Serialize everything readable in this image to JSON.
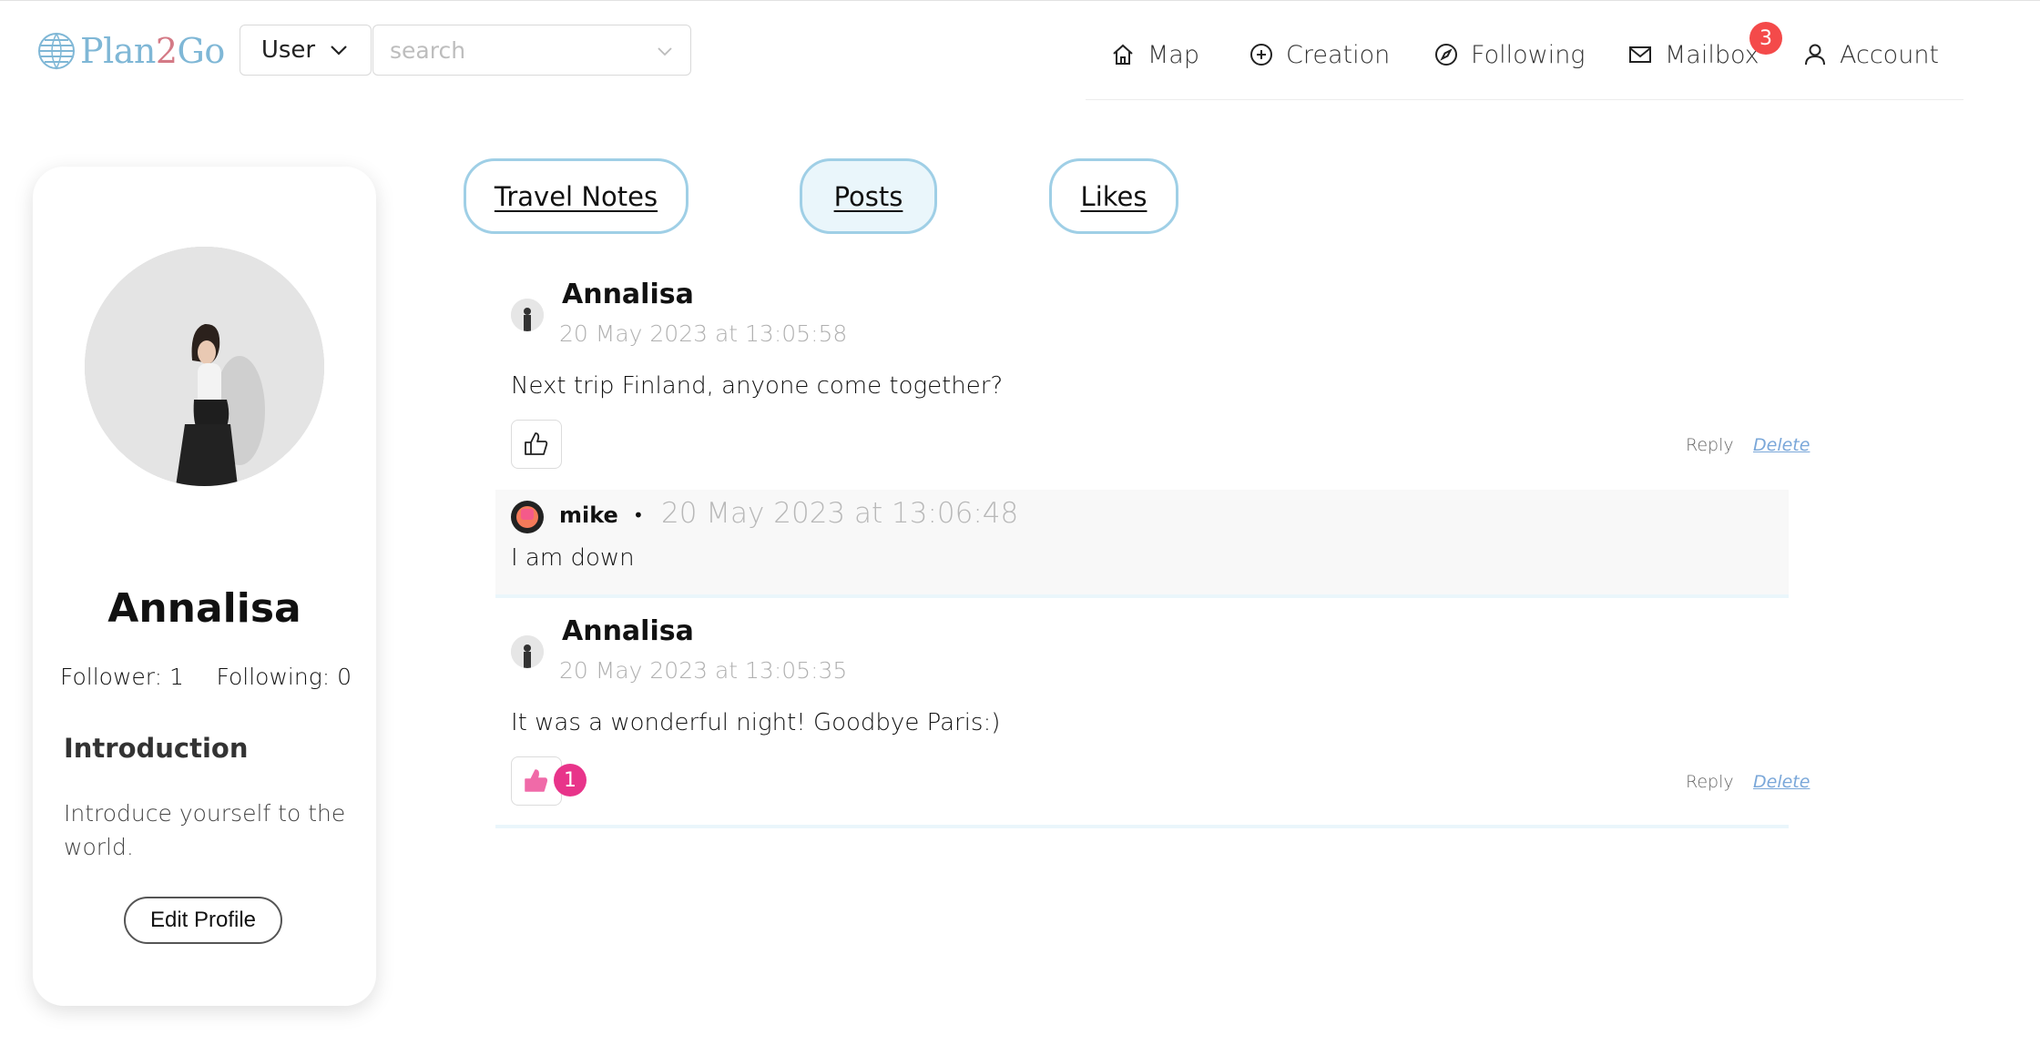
{
  "header": {
    "logo_text_a": "Plan",
    "logo_text_b": "2",
    "logo_text_c": "Go",
    "user_select_value": "User",
    "search_placeholder": "search",
    "nav": [
      {
        "label": "Map",
        "icon": "home-icon"
      },
      {
        "label": "Creation",
        "icon": "plus-circle-icon"
      },
      {
        "label": "Following",
        "icon": "compass-icon"
      },
      {
        "label": "Mailbox",
        "icon": "mail-icon",
        "badge": "3"
      },
      {
        "label": "Account",
        "icon": "user-icon"
      }
    ]
  },
  "profile": {
    "name": "Annalisa",
    "followers": "Follower: 1",
    "following": "Following: 0",
    "intro_title": "Introduction",
    "intro_text": "Introduce yourself to the world.",
    "edit_button": "Edit Profile"
  },
  "tabs": [
    {
      "label": "Travel Notes",
      "active": false
    },
    {
      "label": "Posts",
      "active": true
    },
    {
      "label": "Likes",
      "active": false
    }
  ],
  "posts": [
    {
      "author": "Annalisa",
      "timestamp": "20 May 2023 at 13:05:58",
      "text": "Next trip Finland, anyone come together?",
      "likes": null,
      "reply_label": "Reply",
      "delete_label": "Delete",
      "comments": [
        {
          "author": "mike",
          "separator": "•",
          "timestamp": "20 May 2023 at 13:06:48",
          "text": "I am down"
        }
      ]
    },
    {
      "author": "Annalisa",
      "timestamp": "20 May 2023 at 13:05:35",
      "text": "It was a wonderful night! Goodbye Paris:)",
      "likes": "1",
      "reply_label": "Reply",
      "delete_label": "Delete",
      "comments": []
    }
  ],
  "colors": {
    "accent_blue": "#9fcfe6",
    "badge_red": "#f44a4a",
    "like_pink": "#e8348a",
    "delete_link": "#7aa7d9"
  }
}
